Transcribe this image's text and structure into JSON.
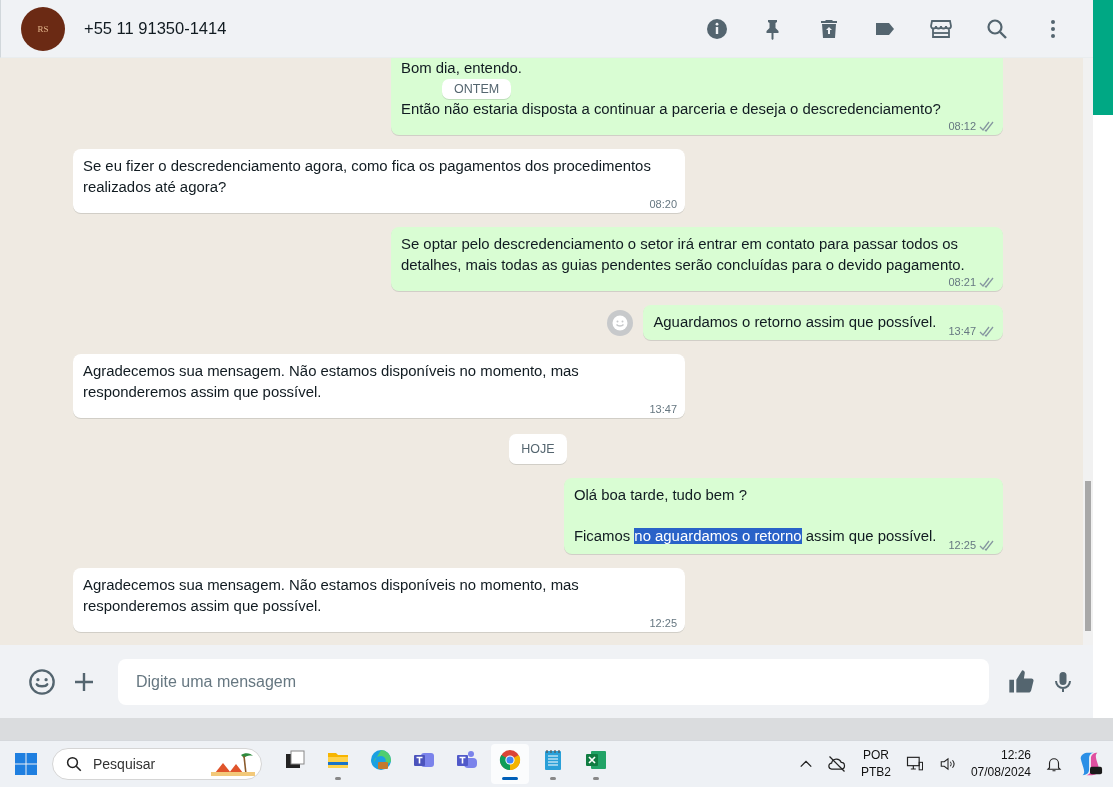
{
  "header": {
    "contact": "+55 11 91350-1414",
    "avatar_text": "RS"
  },
  "messages": [
    {
      "kind": "bubble",
      "outgoing": true,
      "paragraphs": [
        [
          {
            "text": "Bom dia, entendo.",
            "selected": false
          }
        ],
        [
          {
            "text": "Então não estaria disposta a continuar a parceria e deseja o descredenciamento?",
            "selected": false
          }
        ]
      ],
      "time": "08:12",
      "read": false,
      "reaction_button": false
    },
    {
      "kind": "bubble",
      "outgoing": false,
      "paragraphs": [
        [
          {
            "text": "Se eu fizer o descredenciamento agora, como fica os pagamentos dos procedimentos realizados até agora?",
            "selected": false
          }
        ]
      ],
      "time": "08:20"
    },
    {
      "kind": "bubble",
      "outgoing": true,
      "paragraphs": [
        [
          {
            "text": "Se optar pelo descredenciamento o setor irá entrar em contato para passar todos os detalhes, mais todas as guias pendentes serão concluídas para o devido pagamento.",
            "selected": false
          }
        ]
      ],
      "time": "08:21",
      "read": false,
      "reaction_button": false
    },
    {
      "kind": "bubble",
      "outgoing": true,
      "paragraphs": [
        [
          {
            "text": "Aguardamos o retorno assim que possível.",
            "selected": false
          }
        ]
      ],
      "time": "13:47",
      "read": false,
      "reaction_button": true
    },
    {
      "kind": "bubble",
      "outgoing": false,
      "paragraphs": [
        [
          {
            "text": "Agradecemos sua mensagem. Não estamos disponíveis no momento, mas responderemos assim que possível.",
            "selected": false
          }
        ]
      ],
      "time": "13:47"
    },
    {
      "kind": "date",
      "label": "HOJE"
    },
    {
      "kind": "bubble",
      "outgoing": true,
      "paragraphs": [
        [
          {
            "text": "Olá boa tarde, tudo bem ?",
            "selected": false
          }
        ],
        [
          {
            "text": "Ficamos ",
            "selected": false
          },
          {
            "text": "no aguardamos o retorno",
            "selected": true
          },
          {
            "text": " assim que possível.",
            "selected": false
          }
        ]
      ],
      "time": "12:25",
      "read": false,
      "reaction_button": false
    },
    {
      "kind": "bubble",
      "outgoing": false,
      "paragraphs": [
        [
          {
            "text": "Agradecemos sua mensagem. Não estamos disponíveis no momento, mas responderemos assim que possível.",
            "selected": false
          }
        ]
      ],
      "time": "12:25"
    }
  ],
  "floating_date": "ONTEM",
  "composer": {
    "placeholder": "Digite uma mensagem"
  },
  "taskbar": {
    "search_placeholder": "Pesquisar",
    "apps": [
      {
        "kind": "taskview",
        "running": false,
        "active": false
      },
      {
        "kind": "explorer",
        "running": true,
        "active": false
      },
      {
        "kind": "edge",
        "running": false,
        "active": false
      },
      {
        "kind": "teams-classic",
        "running": false,
        "active": false
      },
      {
        "kind": "teams",
        "running": false,
        "active": false
      },
      {
        "kind": "chrome",
        "running": true,
        "active": true
      },
      {
        "kind": "notepad",
        "running": true,
        "active": false
      },
      {
        "kind": "excel",
        "running": true,
        "active": false
      }
    ],
    "language": "POR",
    "layout": "PTB2",
    "time": "12:26",
    "date": "07/08/2024"
  }
}
